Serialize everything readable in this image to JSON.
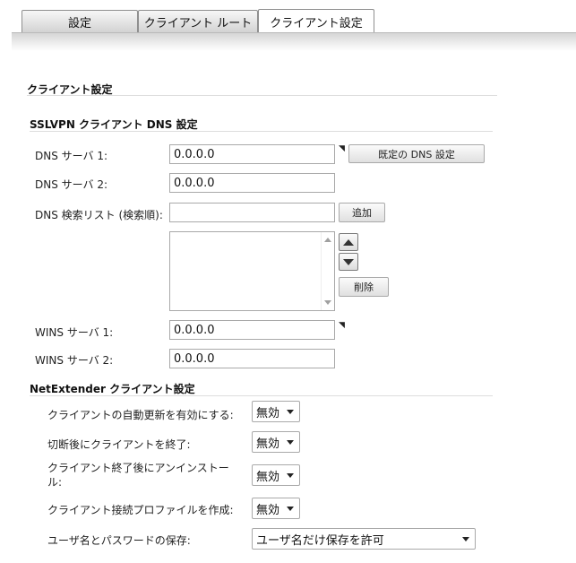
{
  "tabs": [
    {
      "label": "設定"
    },
    {
      "label": "クライアント ルート"
    },
    {
      "label": "クライアント設定"
    }
  ],
  "page_title": "クライアント設定",
  "dns_section": {
    "title": "SSLVPN クライアント DNS 設定",
    "dns1_label": "DNS サーバ 1:",
    "dns1_value": "0.0.0.0",
    "default_dns_button": "既定の DNS 設定",
    "dns2_label": "DNS サーバ 2:",
    "dns2_value": "0.0.0.0",
    "search_list_label": "DNS 検索リスト (検索順):",
    "search_list_value": "",
    "add_button": "追加",
    "delete_button": "削除",
    "wins1_label": "WINS サーバ 1:",
    "wins1_value": "0.0.0.0",
    "wins2_label": "WINS サーバ 2:",
    "wins2_value": "0.0.0.0",
    "required_mark": "◥"
  },
  "netextender_section": {
    "title": "NetExtender クライアント設定",
    "auto_update_label": "クライアントの自動更新を有効にする:",
    "auto_update_value": "無効",
    "exit_after_disconnect_label": "切断後にクライアントを終了:",
    "exit_after_disconnect_value": "無効",
    "uninstall_after_exit_label": "クライアント終了後にアンインストール:",
    "uninstall_after_exit_value": "無効",
    "create_profile_label": "クライアント接続プロファイルを作成:",
    "create_profile_value": "無効",
    "save_credentials_label": "ユーザ名とパスワードの保存:",
    "save_credentials_value": "ユーザ名だけ保存を許可"
  }
}
